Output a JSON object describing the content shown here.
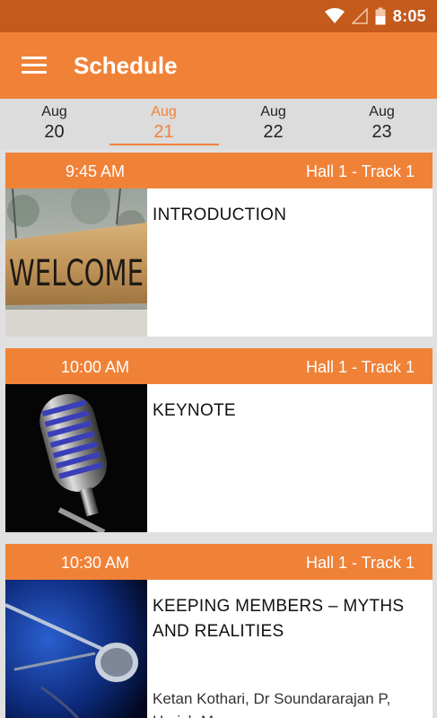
{
  "status_bar": {
    "time": "8:05"
  },
  "app_bar": {
    "title": "Schedule"
  },
  "date_tabs": [
    {
      "month": "Aug",
      "day": "20",
      "selected": false
    },
    {
      "month": "Aug",
      "day": "21",
      "selected": true
    },
    {
      "month": "Aug",
      "day": "22",
      "selected": false
    },
    {
      "month": "Aug",
      "day": "23",
      "selected": false
    }
  ],
  "sessions": [
    {
      "time": "9:45 AM",
      "hall": "Hall 1 - Track 1",
      "title": "INTRODUCTION",
      "speakers": "",
      "image": "welcome-sign-image"
    },
    {
      "time": "10:00 AM",
      "hall": "Hall 1 - Track 1",
      "title": "KEYNOTE",
      "speakers": "",
      "image": "microphone-image"
    },
    {
      "time": "10:30 AM",
      "hall": "Hall 1 - Track 1",
      "title": "KEEPING MEMBERS – MYTHS AND REALITIES",
      "speakers": "Ketan Kothari, Dr Soundararajan P, Harish Mysore",
      "image": "stage-microphone-image"
    }
  ],
  "colors": {
    "primary": "#f08238",
    "status_bar": "#c45a1c",
    "background": "#e0e0e0"
  }
}
